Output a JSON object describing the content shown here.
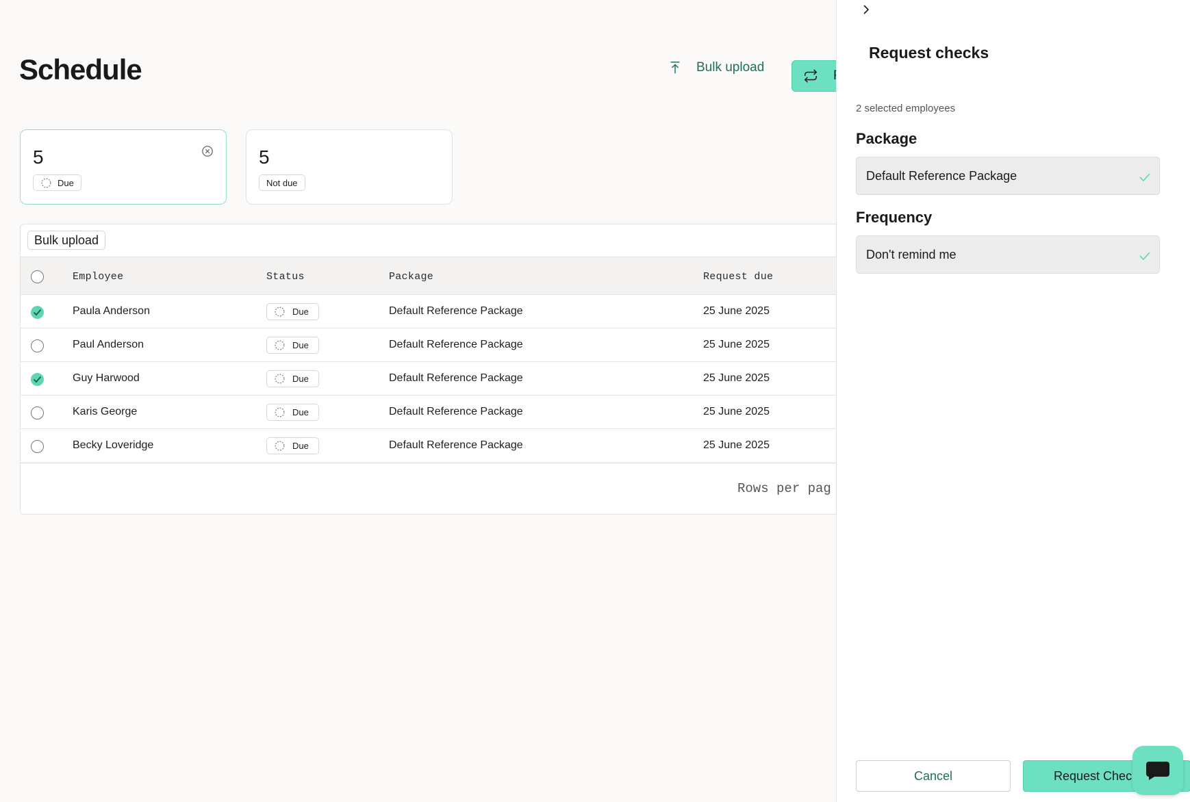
{
  "page": {
    "title": "Schedule"
  },
  "header": {
    "bulk_upload_label": "Bulk upload",
    "primary_label": "R"
  },
  "summary_cards": [
    {
      "count": "5",
      "label": "Due",
      "active": true
    },
    {
      "count": "5",
      "label": "Not due",
      "active": false
    }
  ],
  "table": {
    "toolbar_button": "Bulk upload",
    "columns": [
      "Employee",
      "Status",
      "Package",
      "Request due"
    ],
    "rows": [
      {
        "employee": "Paula Anderson",
        "status": "Due",
        "package": "Default Reference Package",
        "request_due": "25 June 2025",
        "checked": true
      },
      {
        "employee": "Paul Anderson",
        "status": "Due",
        "package": "Default Reference Package",
        "request_due": "25 June 2025",
        "checked": false
      },
      {
        "employee": "Guy Harwood",
        "status": "Due",
        "package": "Default Reference Package",
        "request_due": "25 June 2025",
        "checked": true
      },
      {
        "employee": "Karis George",
        "status": "Due",
        "package": "Default Reference Package",
        "request_due": "25 June 2025",
        "checked": false
      },
      {
        "employee": "Becky Loveridge",
        "status": "Due",
        "package": "Default Reference Package",
        "request_due": "25 June 2025",
        "checked": false
      }
    ],
    "footer_label": "Rows per pag"
  },
  "panel": {
    "title": "Request checks",
    "selected_count": "2 selected employees",
    "package_label": "Package",
    "package_value": "Default Reference Package",
    "frequency_label": "Frequency",
    "frequency_value": "Don't remind me",
    "cancel_label": "Cancel",
    "request_label": "Request Chec"
  },
  "icons": {
    "upload": "upload-icon",
    "refresh": "refresh-icon",
    "clear": "clear-filter-icon",
    "status": "dashed-circle-icon",
    "collapse": "chevron-right-icon",
    "check": "checkmark-icon",
    "chat": "chat-icon"
  },
  "colors": {
    "accent": "#6ee0c2",
    "accent_text": "#1f6f5c",
    "background": "#fbfaf8"
  }
}
